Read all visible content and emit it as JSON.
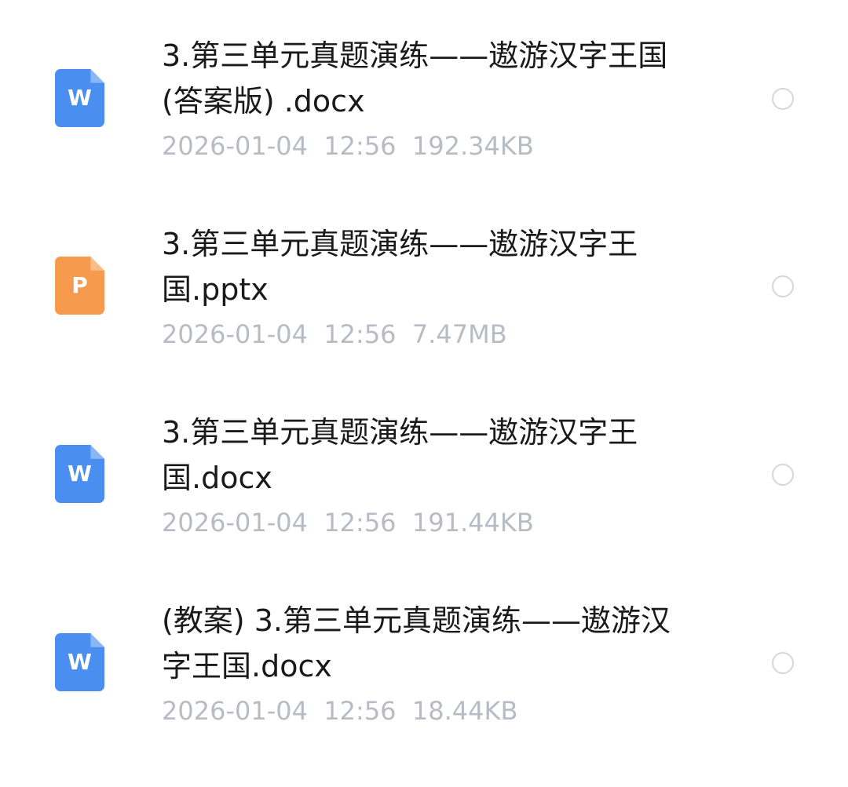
{
  "files": [
    {
      "name_line1": "3.第三单元真题演练——遨游汉字王国",
      "name_line2": "(答案版) .docx",
      "meta": "2026-01-04  12:56  192.34KB",
      "icon": "word-doc-icon",
      "icon_glyph": "W",
      "icon_color": "#4a8ff0"
    },
    {
      "name_line1": "3.第三单元真题演练——遨游汉字王",
      "name_line2": "国.pptx",
      "meta": "2026-01-04  12:56  7.47MB",
      "icon": "ppt-doc-icon",
      "icon_glyph": "P",
      "icon_color": "#f69a4e"
    },
    {
      "name_line1": "3.第三单元真题演练——遨游汉字王",
      "name_line2": "国.docx",
      "meta": "2026-01-04  12:56  191.44KB",
      "icon": "word-doc-icon",
      "icon_glyph": "W",
      "icon_color": "#4a8ff0"
    },
    {
      "name_line1": "(教案) 3.第三单元真题演练——遨游汉",
      "name_line2": "字王国.docx",
      "meta": "2026-01-04  12:56  18.44KB",
      "icon": "word-doc-icon",
      "icon_glyph": "W",
      "icon_color": "#4a8ff0"
    }
  ],
  "colors": {
    "filename_text": "#1a1a1a",
    "meta_text": "#b7bcc4",
    "radio_border": "#d7d7d7",
    "background": "#ffffff"
  }
}
